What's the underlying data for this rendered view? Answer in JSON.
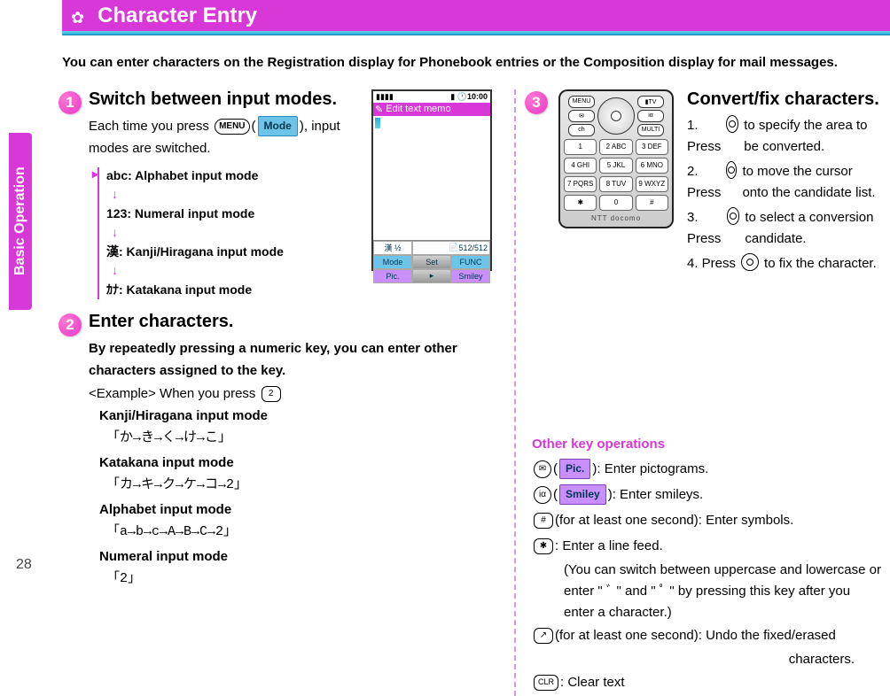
{
  "header": {
    "title": "Character Entry"
  },
  "sidebar": {
    "tab": "Basic Operation"
  },
  "page_number": "28",
  "intro": "You can enter characters on the Registration display for Phonebook entries or the Composition display for mail messages.",
  "steps": {
    "s1": {
      "num": "1",
      "title": "Switch between input modes.",
      "text_a": "Each time you press ",
      "key_menu": "MENU",
      "soft_mode": "Mode",
      "text_b": "), input modes are switched.",
      "modes": {
        "abc": "abc: Alphabet input mode",
        "num": "123: Numeral input mode",
        "kanji": "漢: Kanji/Hiragana input mode",
        "kata": "ｶﾅ: Katakana input mode"
      }
    },
    "s2": {
      "num": "2",
      "title": "Enter characters.",
      "subtitle": "By repeatedly pressing a numeric key, you can enter other characters assigned to the key.",
      "example_label": "<Example> When you press ",
      "key2": "2",
      "kanji_label": "Kanji/Hiragana input mode",
      "kanji_seq": "「か→き→く→け→こ」",
      "kata_label": "Katakana input mode",
      "kata_seq": "「カ→キ→ク→ケ→コ→2」",
      "alpha_label": "Alphabet input mode",
      "alpha_seq": "「a→b→c→A→B→C→2」",
      "num_label": "Numeral input mode",
      "num_seq": "「2」"
    },
    "s3": {
      "num": "3",
      "title": "Convert/fix characters.",
      "items": {
        "i1": "1. Press ",
        "i1b": " to specify the area to be converted.",
        "i2": "2. Press ",
        "i2b": " to move the cursor onto the candidate list.",
        "i3": "3. Press ",
        "i3b": " to select a conversion candidate.",
        "i4": "4. Press ",
        "i4b": " to fix the character."
      }
    }
  },
  "other_ops": {
    "title": "Other key operations",
    "pic_key": "✉",
    "pic_soft": "Pic.",
    "pic_text": "): Enter pictograms.",
    "smiley_key": "iα",
    "smiley_soft": "Smiley",
    "smiley_text": "): Enter smileys.",
    "hash_key": "#",
    "hash_text": "(for at least one second): Enter symbols.",
    "star_key": "✱",
    "star_text": ": Enter a line feed.",
    "star_sub": "(You can switch between uppercase and lowercase or enter \" ﾞ \" and \" ﾟ \" by pressing this key after you enter a character.)",
    "call_key": "↗",
    "call_text": "(for at least one second): Undo the fixed/erased",
    "call_sub": "characters.",
    "clr_key": "CLR",
    "clr_text": ": Clear text"
  },
  "phone": {
    "signal": "▮▮▮▮",
    "bat": "▮",
    "time": "10:00",
    "edit_label": "Edit text memo",
    "memo_left": "漢 ½",
    "memo_right": "512/512",
    "mode": "Mode",
    "func": "FUNC",
    "pic": "Pic.",
    "set": "Set",
    "smiley": "Smiley",
    "top_keys": {
      "menu": "MENU",
      "tv": "▮TV",
      "mail": "✉",
      "ia": "iα"
    },
    "rows": [
      [
        "1",
        "2 ABC",
        "3 DEF"
      ],
      [
        "4 GHI",
        "5 JKL",
        "6 MNO"
      ],
      [
        "7 PQRS",
        "8 TUV",
        "9 WXYZ"
      ],
      [
        "✱",
        "0",
        "#"
      ]
    ],
    "brand": "NTT docomo"
  }
}
